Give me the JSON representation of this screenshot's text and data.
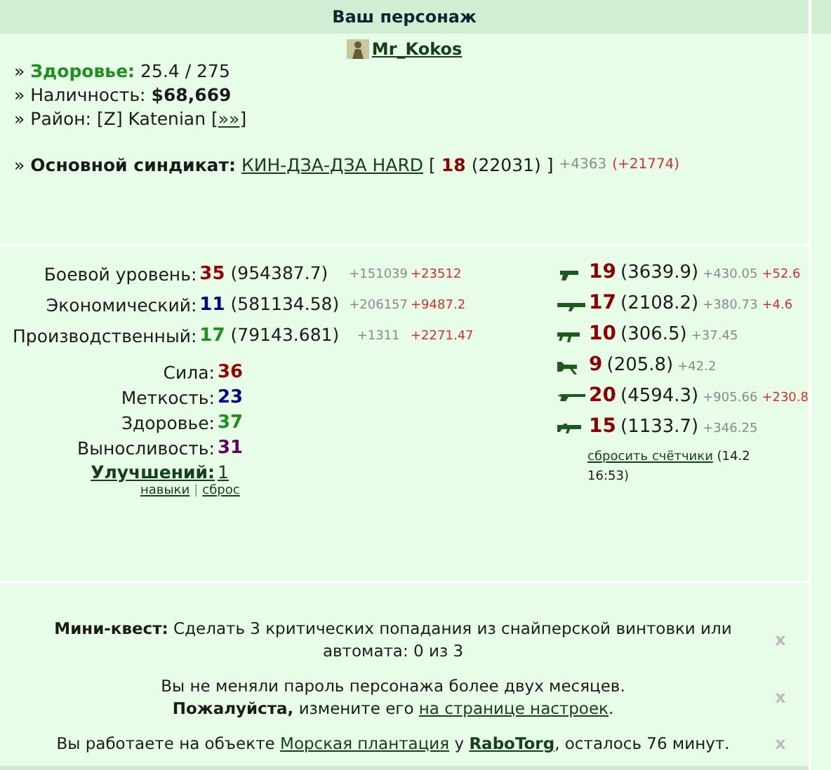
{
  "header": "Ваш персонаж",
  "character": {
    "name": "Mr_Kokos"
  },
  "info": [
    {
      "bullet": "»",
      "label": "Здоровье:",
      "value": "25.4 / 275",
      "kind": "health"
    },
    {
      "bullet": "»",
      "label": "Наличность:",
      "value": "$68,669",
      "kind": "cash"
    },
    {
      "bullet": "»",
      "label": "Район:",
      "value": "[Z] Katenian",
      "open": "[",
      "link": "»»",
      "close": "]",
      "kind": "district"
    }
  ],
  "syndicate": {
    "bullet": "»",
    "label": "Основной синдикат:",
    "name": "КИН-ДЗА-ДЗА HARD",
    "open": "[",
    "level": "18",
    "points": "(22031)",
    "close": "]",
    "gain": "+4363",
    "extra": "(+21774)"
  },
  "levels": [
    {
      "label": "Боевой уровень:",
      "value": "35",
      "color": "#990000",
      "points": "(954387.7)",
      "gain": "+151039",
      "extra": "+23512"
    },
    {
      "label": "Экономический:",
      "value": "11",
      "color": "#000080",
      "points": "(581134.58)",
      "gain": "+206157",
      "extra": "+9487.2"
    },
    {
      "label": "Производственный:",
      "value": "17",
      "color": "#1f8f1f",
      "points": "(79143.681)",
      "gain": "+1311",
      "extra": "+2271.47"
    }
  ],
  "stats": [
    {
      "label": "Сила:",
      "value": "36",
      "color": "#990000"
    },
    {
      "label": "Меткость:",
      "value": "23",
      "color": "#000080"
    },
    {
      "label": "Здоровье:",
      "value": "37",
      "color": "#1f8f1f"
    },
    {
      "label": "Выносливость:",
      "value": "31",
      "color": "#660066"
    }
  ],
  "upgrades": {
    "label": "Улучшений:",
    "value": "1"
  },
  "skill_links": [
    {
      "text": "навыки"
    },
    {
      "text": "сброс"
    }
  ],
  "skill_separator": "|",
  "weapons": [
    {
      "kind": "pistol",
      "level": "19",
      "points": "(3639.9)",
      "gain": "+430.05",
      "extra": "+52.6"
    },
    {
      "kind": "launcher",
      "level": "17",
      "points": "(2108.2)",
      "gain": "+380.73",
      "extra": "+4.6"
    },
    {
      "kind": "smg",
      "level": "10",
      "points": "(306.5)",
      "gain": "+37.45"
    },
    {
      "kind": "machinegun",
      "level": "9",
      "points": "(205.8)",
      "gain": "+42.2"
    },
    {
      "kind": "shotgun",
      "level": "20",
      "points": "(4594.3)",
      "gain": "+905.66",
      "extra": "+230.8"
    },
    {
      "kind": "rifle",
      "level": "15",
      "points": "(1133.7)",
      "gain": "+346.25"
    }
  ],
  "reset": {
    "link": "сбросить счётчики",
    "text": "(14.2 16:53)"
  },
  "notices": [
    {
      "close": "x",
      "parts": [
        {
          "kind": "bold",
          "text": "Мини-квест:"
        },
        {
          "kind": "text",
          "text": " Сделать 3 критических попадания из снайперской винтовки или автомата: 0 из 3"
        }
      ]
    },
    {
      "close": "x",
      "parts": [
        {
          "kind": "text",
          "text": "Вы не меняли пароль персонажа более двух месяцев."
        },
        {
          "kind": "break"
        },
        {
          "kind": "bold",
          "text": "Пожалуйста,"
        },
        {
          "kind": "text",
          "text": " измените его "
        },
        {
          "kind": "link",
          "text": "на странице настроек"
        },
        {
          "kind": "text",
          "text": "."
        }
      ]
    },
    {
      "close": "x",
      "parts": [
        {
          "kind": "text",
          "text": "Вы работаете на объекте "
        },
        {
          "kind": "link",
          "text": "Морская плантация"
        },
        {
          "kind": "text",
          "text": " у "
        },
        {
          "kind": "boldlink",
          "text": "RaboTorg"
        },
        {
          "kind": "text",
          "text": ", осталось 76 минут."
        }
      ]
    }
  ]
}
